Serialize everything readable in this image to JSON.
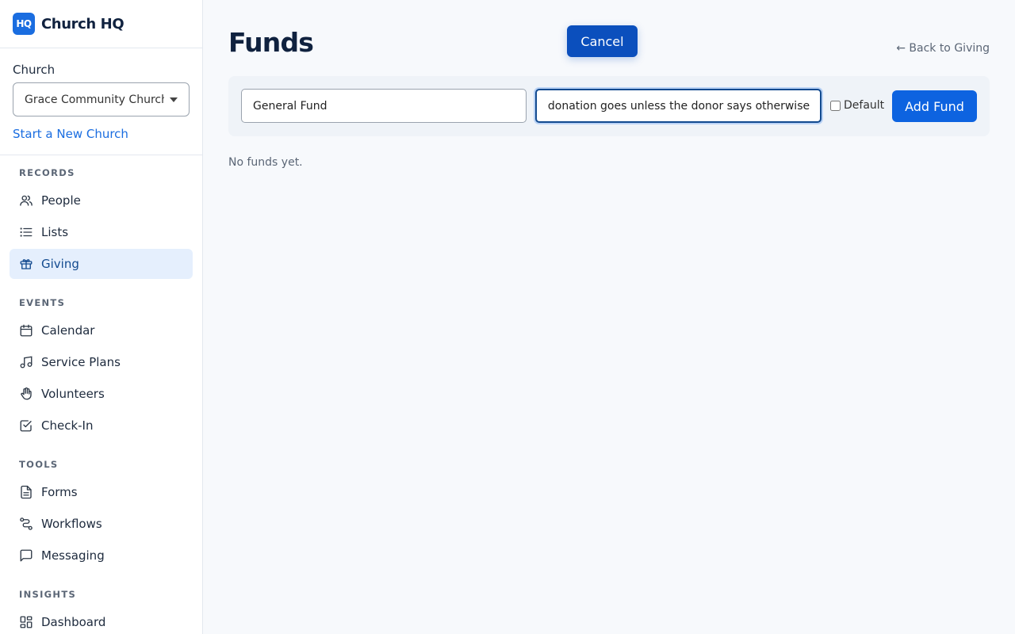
{
  "brand": {
    "logo_text": "HQ",
    "name": "Church HQ",
    "accent": "#1a6de0"
  },
  "church": {
    "label": "Church",
    "selected": "Grace Community Church",
    "new_link": "Start a New Church"
  },
  "nav": {
    "records": "RECORDS",
    "events": "EVENTS",
    "tools": "TOOLS",
    "insights": "INSIGHTS",
    "items": {
      "people": "People",
      "lists": "Lists",
      "giving": "Giving",
      "calendar": "Calendar",
      "service_plans": "Service Plans",
      "volunteers": "Volunteers",
      "check_in": "Check-In",
      "forms": "Forms",
      "workflows": "Workflows",
      "messaging": "Messaging",
      "dashboard": "Dashboard"
    },
    "active": "giving"
  },
  "page": {
    "title": "Funds",
    "cancel": "Cancel",
    "back": "← Back to Giving",
    "empty": "No funds yet."
  },
  "form": {
    "name_value": "General Fund",
    "desc_value": "Where a donation goes unless the donor says otherwise",
    "default_label": "Default",
    "default_checked": false,
    "submit": "Add Fund"
  }
}
